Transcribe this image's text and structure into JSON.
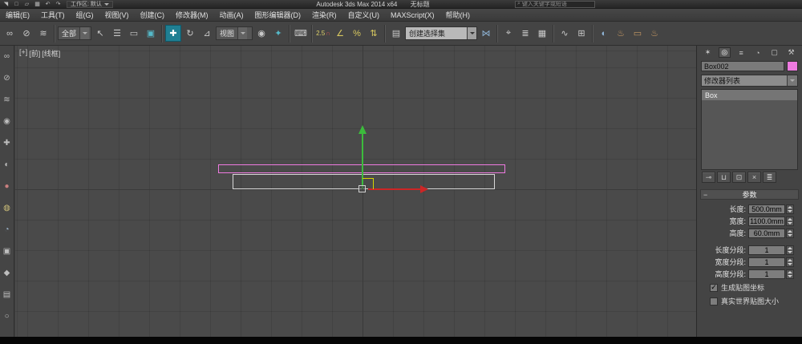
{
  "icons": {
    "app_logo": "◥",
    "new_doc": "□",
    "open_folder": "▱",
    "save": "▦",
    "undo": "↶",
    "redo": "↷",
    "search": "⌕",
    "select_link": "∞",
    "unlink": "⊘",
    "bind_spacewarp": "≋",
    "select_object": "↖",
    "select_by_name": "☰",
    "rect_region": "▭",
    "window_crossing": "▣",
    "move": "✚",
    "rotate": "↻",
    "scale": "⊿",
    "pivot_center": "◉",
    "manipulate": "✦",
    "keyboard_override": "⌨",
    "magnet": "∩",
    "angle_snap": "∠",
    "percent_snap": "%",
    "spinner_snap": "⇅",
    "edit_named_sets": "▤",
    "mirror": "⋈",
    "align": "⌖",
    "layer_manager": "≣",
    "graphite": "▦",
    "curve_editor": "∿",
    "schematic_view": "⊞",
    "material_editor": "◐",
    "render_setup": "♨",
    "rendered_frame": "▭",
    "render_production": "♨",
    "tab_create": "✶",
    "tab_modify": "◎",
    "tab_hierarchy": "≡",
    "tab_motion": "◔",
    "tab_display": "▢",
    "tab_utilities": "⚒",
    "pin_stack": "⊸",
    "show_end_result": "⊔",
    "make_unique": "⊡",
    "remove_modifier": "×",
    "configure_sets": "≣",
    "check": "✓",
    "collapse": "−"
  },
  "titlebar": {
    "workspace": "工作区: 默认",
    "title": "Autodesk 3ds Max  2014 x64",
    "doc_title": "无标题",
    "search_placeholder": "键入关键字或短语"
  },
  "menubar": {
    "items": [
      "编辑(E)",
      "工具(T)",
      "组(G)",
      "视图(V)",
      "创建(C)",
      "修改器(M)",
      "动画(A)",
      "图形编辑器(D)",
      "渲染(R)",
      "自定义(U)",
      "MAXScript(X)",
      "帮助(H)"
    ]
  },
  "toolbar": {
    "selection_filter": "全部",
    "coord_system": "视图",
    "snap_mode": "2.5",
    "named_selection_placeholder": "创建选择集"
  },
  "left_toolbar": {
    "icons": [
      "∞",
      "⊘",
      "≋",
      "◉",
      "✚",
      "◐",
      "●",
      "◍",
      "◔",
      "▣",
      "◆",
      "▤",
      "○"
    ]
  },
  "viewport": {
    "menu_general": "[+]",
    "menu_pov": "[前]",
    "menu_shading": "[线框]"
  },
  "command_panel": {
    "object_name": "Box002",
    "object_color": "#ee7ae0",
    "modifier_list": "修改器列表",
    "stack": [
      "Box"
    ],
    "rollout_params_title": "参数",
    "params": [
      {
        "label": "长度:",
        "value": "500.0mm"
      },
      {
        "label": "宽度:",
        "value": "1100.0mm"
      },
      {
        "label": "高度:",
        "value": "60.0mm"
      },
      {
        "label": "长度分段:",
        "value": "1"
      },
      {
        "label": "宽度分段:",
        "value": "1"
      },
      {
        "label": "高度分段:",
        "value": "1"
      }
    ],
    "checkbox_generate_uv": {
      "label": "生成贴图坐标",
      "checked": true
    },
    "checkbox_real_world": {
      "label": "真实世界贴图大小",
      "checked": false
    }
  }
}
